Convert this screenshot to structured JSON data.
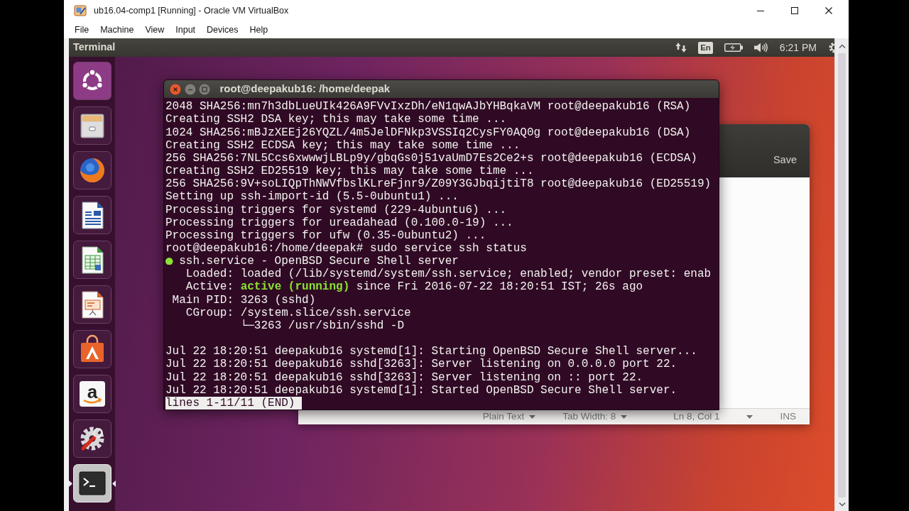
{
  "host_window": {
    "title": "ub16.04-comp1 [Running] - Oracle VM VirtualBox",
    "menu": [
      "File",
      "Machine",
      "View",
      "Input",
      "Devices",
      "Help"
    ]
  },
  "top_panel": {
    "app_name": "Terminal",
    "keyboard_layout": "En",
    "clock": "6:21 PM"
  },
  "launcher": [
    {
      "kind": "home",
      "selected": false
    },
    {
      "kind": "files",
      "selected": false
    },
    {
      "kind": "browser",
      "selected": false
    },
    {
      "kind": "writer",
      "selected": false
    },
    {
      "kind": "calc",
      "selected": false
    },
    {
      "kind": "impress",
      "selected": false
    },
    {
      "kind": "store",
      "selected": false
    },
    {
      "kind": "shop",
      "glyph": "a",
      "selected": false
    },
    {
      "kind": "settings",
      "selected": false
    },
    {
      "kind": "terminal",
      "selected": true
    }
  ],
  "editor_window": {
    "header_button": "Save",
    "status_bar": [
      {
        "kind": "dropdown",
        "label": "Plain Text"
      },
      {
        "kind": "dropdown",
        "label": "Tab Width: 8"
      },
      {
        "kind": "text",
        "label": "Ln 8, Col 1"
      },
      {
        "kind": "caret"
      },
      {
        "kind": "text",
        "label": "INS"
      }
    ]
  },
  "terminal": {
    "title": "root@deepakub16: /home/deepak",
    "lines": [
      {
        "kind": "text",
        "text": "2048 SHA256:mn7h3dbLueUIk426A9FVvIxzDh/eN1qwAJbYHBqkaVM root@deepakub16 (RSA)"
      },
      {
        "kind": "text",
        "text": "Creating SSH2 DSA key; this may take some time ..."
      },
      {
        "kind": "text",
        "text": "1024 SHA256:mBJzXEEj26YQZL/4m5JelDFNkp3VSSIq2CysFY0AQ0g root@deepakub16 (DSA)"
      },
      {
        "kind": "text",
        "text": "Creating SSH2 ECDSA key; this may take some time ..."
      },
      {
        "kind": "text",
        "text": "256 SHA256:7NL5Ccs6xwwwjLBLp9y/gbqGs0j51vaUmD7Es2Ce2+s root@deepakub16 (ECDSA)"
      },
      {
        "kind": "text",
        "text": "Creating SSH2 ED25519 key; this may take some time ..."
      },
      {
        "kind": "text",
        "text": "256 SHA256:9V+soLIQpThNWVfbslKLreFjnr9/Z09Y3GJbqijtiT8 root@deepakub16 (ED25519)"
      },
      {
        "kind": "text",
        "text": "Setting up ssh-import-id (5.5-0ubuntu1) ..."
      },
      {
        "kind": "text",
        "text": "Processing triggers for systemd (229-4ubuntu6) ..."
      },
      {
        "kind": "text",
        "text": "Processing triggers for ureadahead (0.100.0-19) ..."
      },
      {
        "kind": "text",
        "text": "Processing triggers for ufw (0.35-0ubuntu2) ..."
      },
      {
        "kind": "text",
        "text": "root@deepakub16:/home/deepak# sudo service ssh status"
      },
      {
        "kind": "unit",
        "active": true,
        "text": "ssh.service - OpenBSD Secure Shell server"
      },
      {
        "kind": "text",
        "text": "   Loaded: loaded (/lib/systemd/system/ssh.service; enabled; vendor preset: enab"
      },
      {
        "kind": "text",
        "text": "   Active: **active (running)** since Fri 2016-07-22 18:20:51 IST; 26s ago"
      },
      {
        "kind": "text",
        "text": " Main PID: 3263 (sshd)"
      },
      {
        "kind": "text",
        "text": "   CGroup: /system.slice/ssh.service"
      },
      {
        "kind": "text",
        "text": "           └─3263 /usr/sbin/sshd -D"
      },
      {
        "kind": "blank"
      },
      {
        "kind": "text",
        "text": "Jul 22 18:20:51 deepakub16 systemd[1]: Starting OpenBSD Secure Shell server..."
      },
      {
        "kind": "text",
        "text": "Jul 22 18:20:51 deepakub16 sshd[3263]: Server listening on 0.0.0.0 port 22."
      },
      {
        "kind": "text",
        "text": "Jul 22 18:20:51 deepakub16 sshd[3263]: Server listening on :: port 22."
      },
      {
        "kind": "text",
        "text": "Jul 22 18:20:51 deepakub16 systemd[1]: Started OpenBSD Secure Shell server."
      },
      {
        "kind": "pager",
        "text": "lines 1-11/11 (END)"
      }
    ]
  }
}
